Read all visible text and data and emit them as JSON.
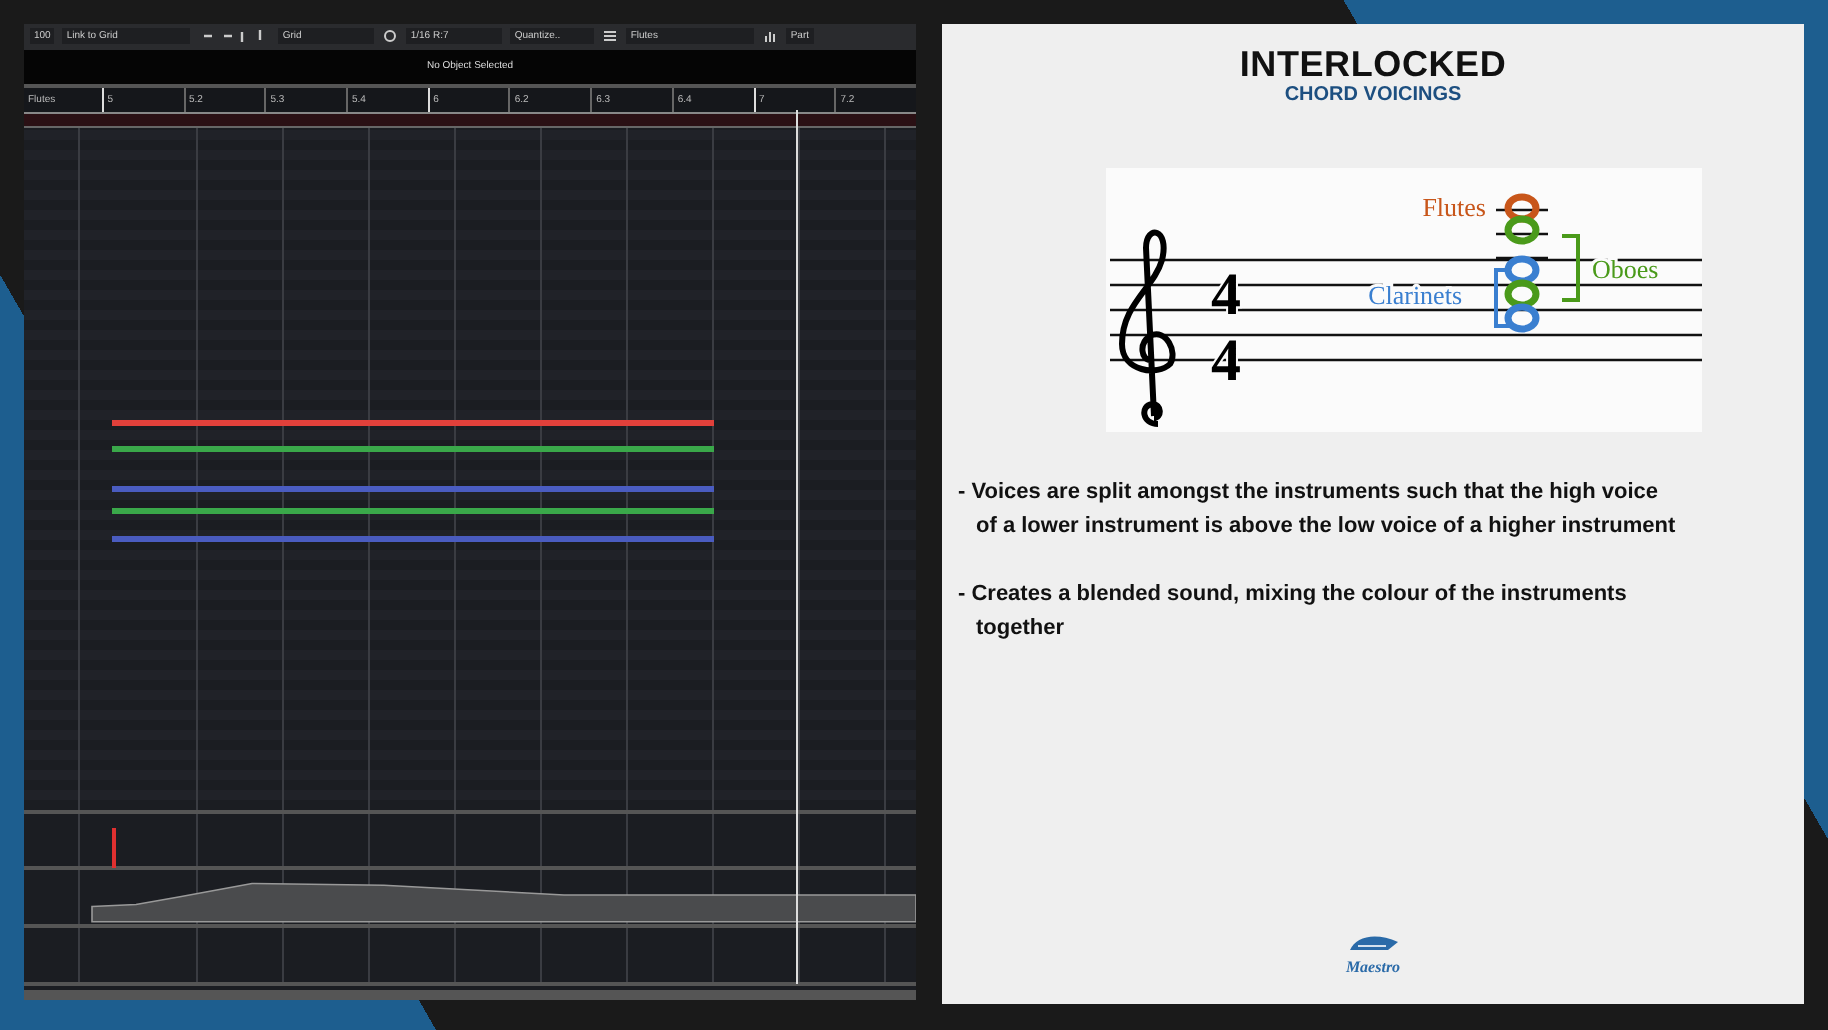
{
  "toolbar": {
    "snap_value": "100",
    "link_mode": "Link to Grid",
    "grid_type": "Grid",
    "quantize_value": "1/16 R:7",
    "quantize_preset": "Quantize..",
    "track": "Flutes",
    "part_button": "Part"
  },
  "info_line": {
    "text": "No Object Selected"
  },
  "ruler": {
    "track_label": "Flutes",
    "marks": [
      "5",
      "5.2",
      "5.3",
      "5.4",
      "6",
      "6.2",
      "6.3",
      "6.4",
      "7",
      "7.2"
    ]
  },
  "notes": [
    {
      "color": "#e0403a"
    },
    {
      "color": "#3aa84a"
    },
    {
      "color": "#4a5cc0"
    },
    {
      "color": "#3aa84a"
    },
    {
      "color": "#4a5cc0"
    }
  ],
  "slide": {
    "title": "INTERLOCKED",
    "subtitle": "CHORD VOICINGS",
    "score": {
      "time_signature": [
        "4",
        "4"
      ],
      "labels": [
        {
          "text": "Flutes",
          "color": "#c8561a"
        },
        {
          "text": "Clarinets",
          "color": "#3a7fd0"
        },
        {
          "text": "Oboes",
          "color": "#4a9a1a"
        }
      ]
    },
    "bullets": [
      "- Voices are split amongst the instruments such that the high voice of a lower instrument is above the low voice of a higher instrument",
      "- Creates a blended sound, mixing the colour of the instruments together"
    ],
    "logo_text": "Maestro"
  }
}
